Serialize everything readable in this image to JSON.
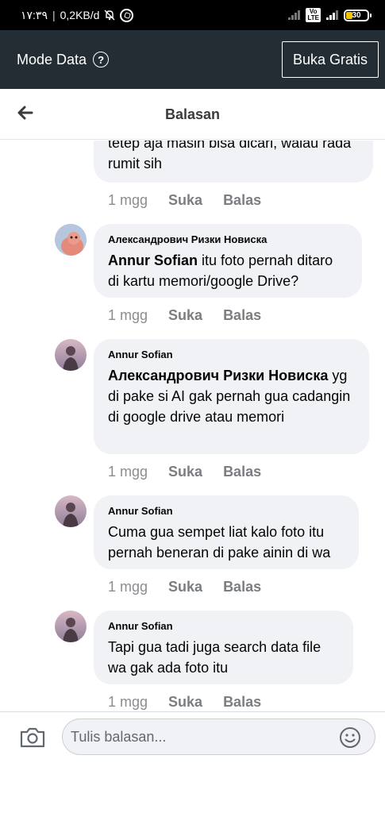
{
  "status_bar": {
    "time": "١٧:٣٩",
    "speed": "0,2KB/d",
    "network": "LTE",
    "battery": "30"
  },
  "mode_bar": {
    "label": "Mode Data",
    "cta": "Buka Gratis"
  },
  "header": {
    "title": "Balasan"
  },
  "comments": [
    {
      "author": "",
      "tag": "",
      "text": "tetep aja masih bisa dicari, walau rada rumit sih",
      "time": "1 mgg",
      "like": "Suka",
      "reply": "Balas"
    },
    {
      "author": "Александрович Ризки Новиска",
      "tag": "Annur Sofian",
      "text": " itu foto pernah ditaro di kartu memori/google Drive?",
      "time": "1 mgg",
      "like": "Suka",
      "reply": "Balas"
    },
    {
      "author": "Annur Sofian",
      "tag": "Александрович Ризки Новиска",
      "text": " yg di pake si AI gak pernah gua cadangin di google drive atau memori",
      "time": "1 mgg",
      "like": "Suka",
      "reply": "Balas"
    },
    {
      "author": "Annur Sofian",
      "tag": "",
      "text": "Cuma gua sempet liat kalo foto itu pernah beneran di pake ainin di wa",
      "time": "1 mgg",
      "like": "Suka",
      "reply": "Balas"
    },
    {
      "author": "Annur Sofian",
      "tag": "",
      "text": "Tapi gua tadi juga search data file wa gak ada foto itu",
      "time": "1 mgg",
      "like": "Suka",
      "reply": "Balas"
    }
  ],
  "composer": {
    "placeholder": "Tulis balasan..."
  },
  "icons": {
    "back": "back-arrow-icon",
    "help": "help-circle-icon",
    "camera": "camera-icon",
    "emoji": "smile-icon"
  },
  "colors": {
    "top_bar": "#232d33",
    "bubble": "#f0f2f5",
    "muted": "#8a8d91"
  }
}
